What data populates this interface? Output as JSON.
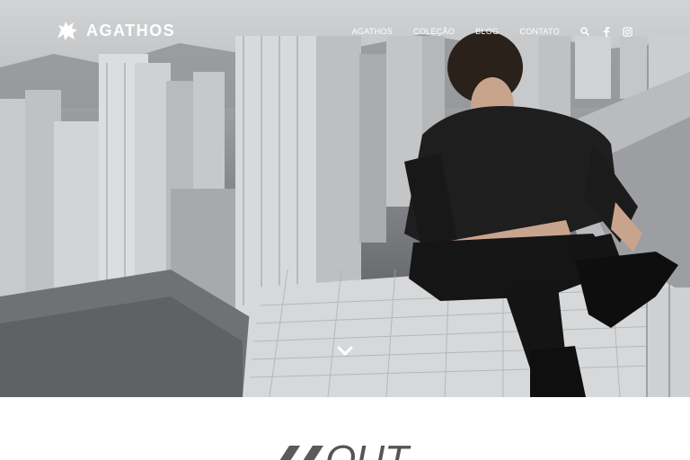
{
  "brand": {
    "name": "AGATHOS",
    "logo_icon": "griffin-icon"
  },
  "nav": {
    "items": [
      {
        "label": "AGATHOS"
      },
      {
        "label": "COLEÇÃO"
      },
      {
        "label": "BLOG"
      },
      {
        "label": "CONTATO"
      }
    ],
    "search_icon": "search-icon",
    "facebook_icon": "facebook-icon",
    "instagram_icon": "instagram-icon"
  },
  "hero": {
    "scroll_icon": "chevron-down-icon"
  },
  "collection": {
    "heading": "OUT"
  },
  "colors": {
    "nav_text": "#ffffff",
    "hero_dark": "#4d4f52",
    "heading": "#555555"
  }
}
